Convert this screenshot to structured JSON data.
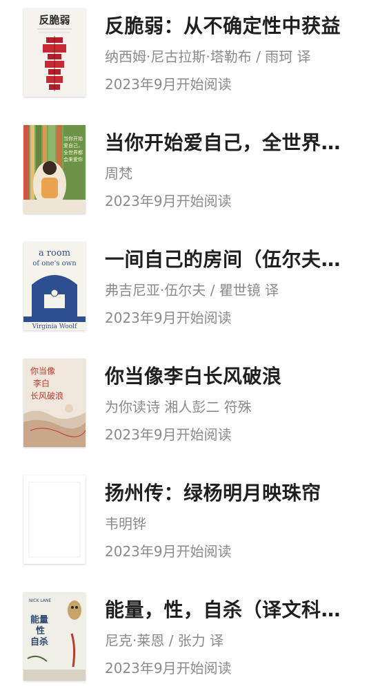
{
  "books": [
    {
      "title": "反脆弱：从不确定性中获益",
      "author": "纳西姆·尼古拉斯·塔勒布 / 雨珂 译",
      "date": "2023年9月开始阅读",
      "cover": {
        "name": "cover-antifragile",
        "text": "反脆弱",
        "bg": "#f3efe8",
        "accent": "#b21e2a"
      }
    },
    {
      "title": "当你开始爱自己，全世界都…",
      "author": "周梵",
      "date": "2023年9月开始阅读",
      "cover": {
        "name": "cover-love-yourself",
        "text": "当你开始 爱自己，全世界都会来爱你",
        "bg": "#6e9a4a",
        "accent": "#e2a25a"
      }
    },
    {
      "title": "一间自己的房间（伍尔夫文…",
      "author": "弗吉尼亚·伍尔夫 / 瞿世镜 译",
      "date": "2023年9月开始阅读",
      "cover": {
        "name": "cover-room-of-ones-own",
        "text_top": "a room of one's own",
        "text_bottom": "Virginia Woolf",
        "bg": "#f6f3ea",
        "accent": "#2e4f8f"
      }
    },
    {
      "title": "你当像李白长风破浪",
      "author": "为你读诗 湘人彭二 符殊",
      "date": "2023年9月开始阅读",
      "cover": {
        "name": "cover-li-bai",
        "text": "你当像 李白 长风破浪",
        "bg": "#efe7dc",
        "accent": "#b93a2a"
      }
    },
    {
      "title": "扬州传：绿杨明月映珠帘",
      "author": "韦明铧",
      "date": "2023年9月开始阅读",
      "cover": {
        "name": "cover-yangzhou-blank",
        "bg": "#ffffff",
        "accent": "#e6e6e6"
      }
    },
    {
      "title": "能量，性，自杀（译文科学…",
      "author": "尼克·莱恩 / 张力 译",
      "date": "2023年9月开始阅读",
      "cover": {
        "name": "cover-power-sex-suicide",
        "text": "能量 性 自杀",
        "text_top": "NICK LANE",
        "bg": "#efeee7",
        "accent": "#2d4a6f"
      }
    }
  ]
}
